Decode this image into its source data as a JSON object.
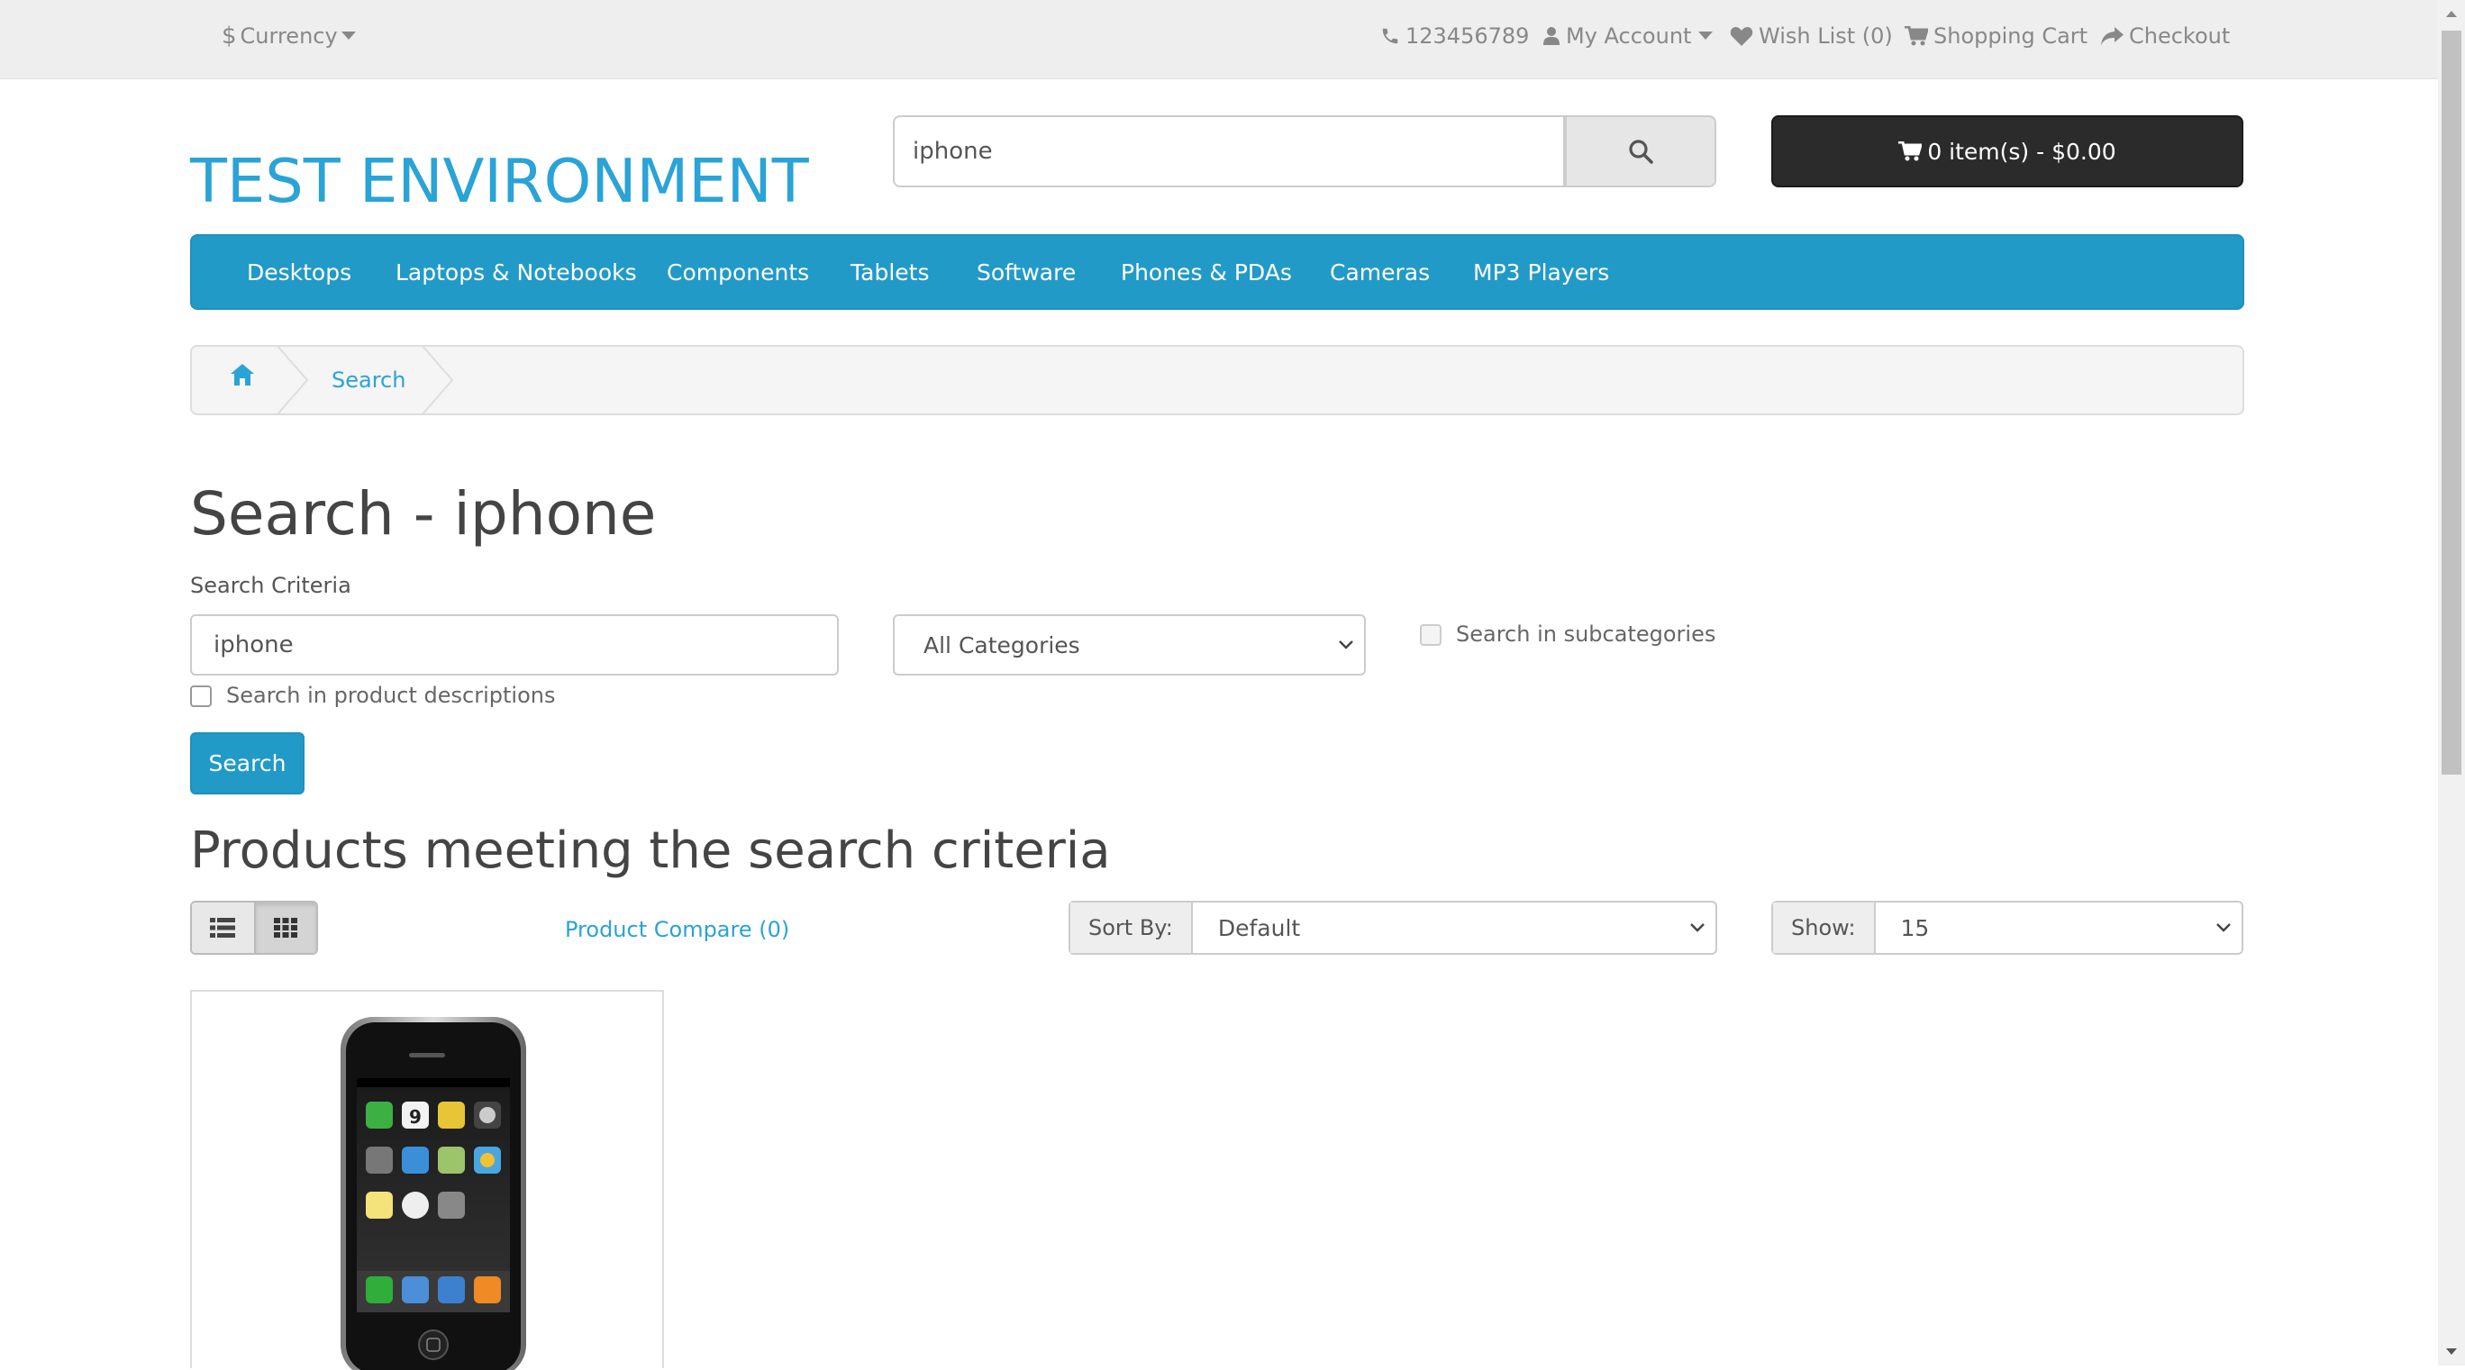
{
  "topbar": {
    "currency_label": "Currency",
    "phone": "123456789",
    "my_account": "My Account",
    "wish_list": "Wish List (0)",
    "shopping_cart": "Shopping Cart",
    "checkout": "Checkout"
  },
  "header": {
    "logo": "TEST ENVIRONMENT",
    "search_value": "iphone",
    "cart_total": "0 item(s) - $0.00"
  },
  "menu": {
    "items": [
      "Desktops",
      "Laptops & Notebooks",
      "Components",
      "Tablets",
      "Software",
      "Phones & PDAs",
      "Cameras",
      "MP3 Players"
    ]
  },
  "breadcrumb": {
    "current": "Search"
  },
  "content": {
    "title": "Search - iphone",
    "criteria_label": "Search Criteria",
    "criteria_value": "iphone",
    "category_selected": "All Categories",
    "search_subcategories": "Search in subcategories",
    "search_descriptions": "Search in product descriptions",
    "search_button": "Search",
    "results_title": "Products meeting the search criteria",
    "product_compare": "Product Compare (0)",
    "sort_label": "Sort By:",
    "sort_value": "Default",
    "show_label": "Show:",
    "show_value": "15"
  },
  "colors": {
    "accent": "#229ac8",
    "link": "#2aa3d6",
    "cart_button": "#2b2b2b",
    "topbar": "#eeeeee"
  },
  "icons": [
    "dollar-icon",
    "caret-down-icon",
    "phone-icon",
    "user-icon",
    "heart-icon",
    "cart-icon",
    "share-icon",
    "search-icon",
    "home-icon",
    "list-view-icon",
    "grid-view-icon",
    "chevron-down-icon"
  ]
}
